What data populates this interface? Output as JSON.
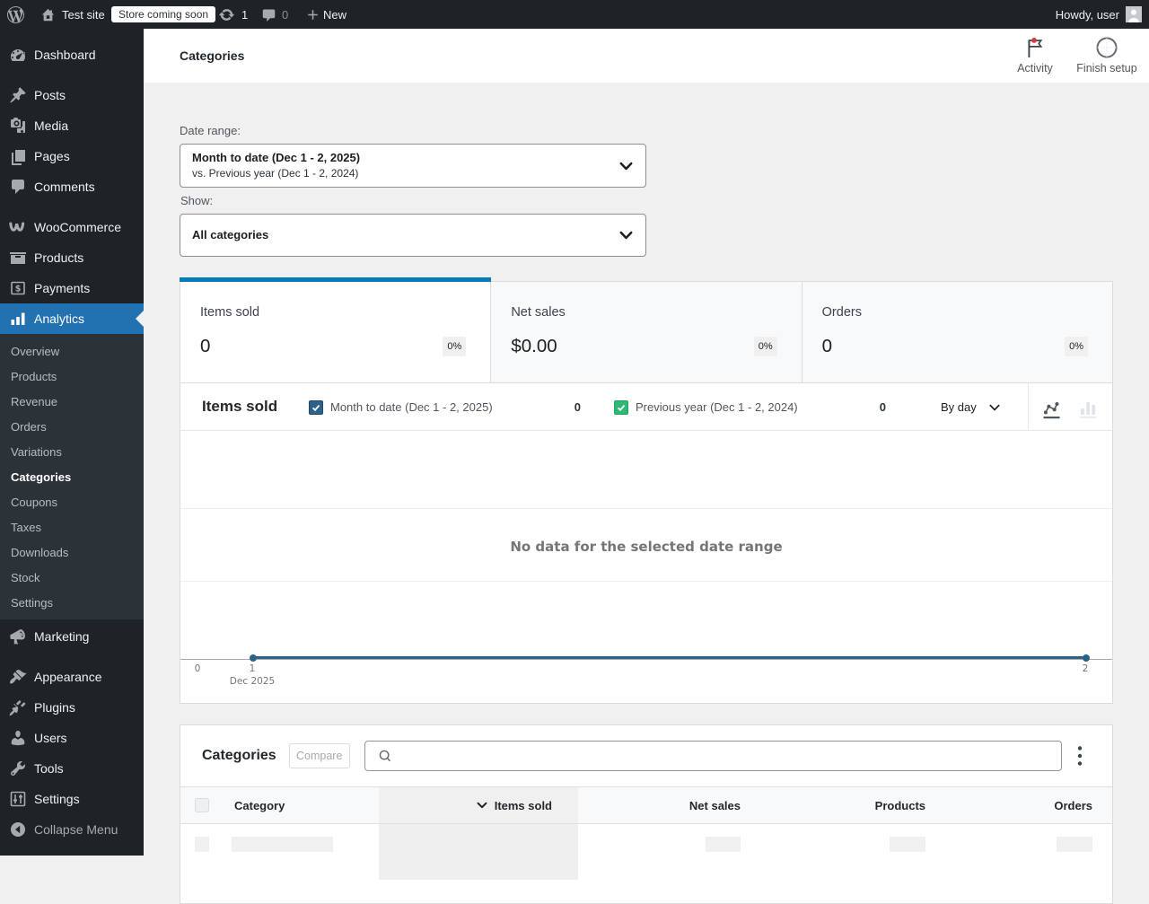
{
  "admin_bar": {
    "site_name": "Test site",
    "badge": "Store coming soon",
    "updates_count": "1",
    "comments_count": "0",
    "new_label": "New",
    "howdy": "Howdy, user"
  },
  "sidebar": {
    "items": [
      {
        "label": "Dashboard"
      },
      {
        "label": "Posts"
      },
      {
        "label": "Media"
      },
      {
        "label": "Pages"
      },
      {
        "label": "Comments"
      },
      {
        "label": "WooCommerce"
      },
      {
        "label": "Products"
      },
      {
        "label": "Payments"
      },
      {
        "label": "Analytics"
      },
      {
        "label": "Marketing"
      },
      {
        "label": "Appearance"
      },
      {
        "label": "Plugins"
      },
      {
        "label": "Users"
      },
      {
        "label": "Tools"
      },
      {
        "label": "Settings"
      }
    ],
    "analytics_submenu": [
      {
        "label": "Overview"
      },
      {
        "label": "Products"
      },
      {
        "label": "Revenue"
      },
      {
        "label": "Orders"
      },
      {
        "label": "Variations"
      },
      {
        "label": "Categories"
      },
      {
        "label": "Coupons"
      },
      {
        "label": "Taxes"
      },
      {
        "label": "Downloads"
      },
      {
        "label": "Stock"
      },
      {
        "label": "Settings"
      }
    ],
    "collapse_label": "Collapse Menu"
  },
  "header": {
    "title": "Categories",
    "activity_label": "Activity",
    "finish_setup_label": "Finish setup"
  },
  "filters": {
    "date_range_label": "Date range:",
    "date_range_primary": "Month to date (Dec 1 - 2, 2025)",
    "date_range_secondary": "vs. Previous year (Dec 1 - 2, 2024)",
    "show_label": "Show:",
    "show_value": "All categories"
  },
  "summary": {
    "tiles": [
      {
        "label": "Items sold",
        "value": "0",
        "delta": "0%"
      },
      {
        "label": "Net sales",
        "value": "$0.00",
        "delta": "0%"
      },
      {
        "label": "Orders",
        "value": "0",
        "delta": "0%"
      }
    ]
  },
  "chart": {
    "title": "Items sold",
    "legend": [
      {
        "label": "Month to date (Dec 1 - 2, 2025)",
        "total": "0",
        "color": "#2c6288"
      },
      {
        "label": "Previous year (Dec 1 - 2, 2024)",
        "total": "0",
        "color": "#2eb873"
      }
    ],
    "interval": "By day",
    "empty_message": "No data for the selected date range",
    "x_ticks": [
      "0",
      "1",
      "2"
    ],
    "x_sublabel": "Dec 2025",
    "line_color": "#2c6288"
  },
  "chart_data": {
    "type": "line",
    "title": "Items sold",
    "x": [
      1,
      2
    ],
    "series": [
      {
        "name": "Month to date (Dec 1 - 2, 2025)",
        "values": [
          0,
          0
        ],
        "color": "#2c6288"
      },
      {
        "name": "Previous year (Dec 1 - 2, 2024)",
        "values": [
          0,
          0
        ],
        "color": "#2eb873"
      }
    ],
    "xlabel": "Dec 2025",
    "x_ticks": [
      "0",
      "1",
      "2"
    ],
    "ylim": [
      0,
      1
    ],
    "grid": true,
    "legend_position": "top"
  },
  "table": {
    "title": "Categories",
    "compare_label": "Compare",
    "search_placeholder": "",
    "search_value": "",
    "columns": [
      {
        "label": "Category"
      },
      {
        "label": "Items sold"
      },
      {
        "label": "Net sales"
      },
      {
        "label": "Products"
      },
      {
        "label": "Orders"
      }
    ],
    "sorted_column": "Items sold"
  }
}
